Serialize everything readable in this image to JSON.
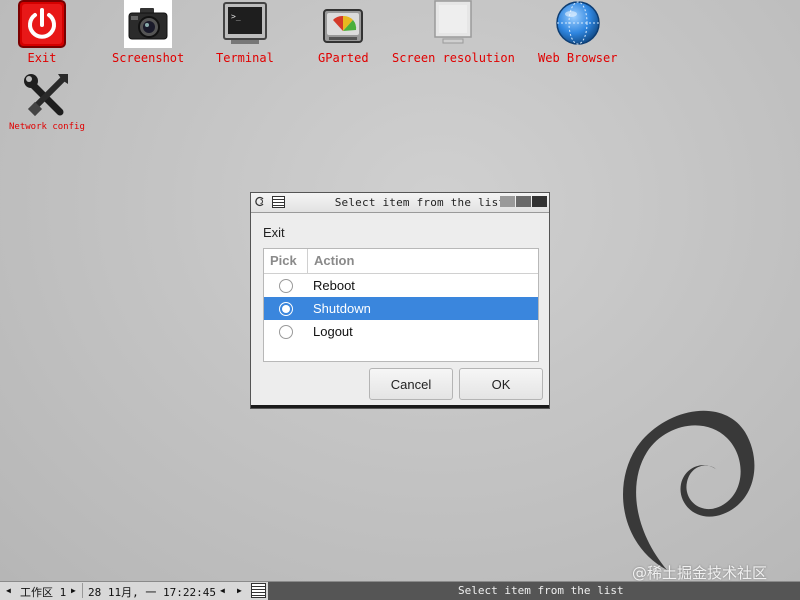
{
  "desktop": {
    "icons": [
      {
        "label": "Exit",
        "icon": "power-icon"
      },
      {
        "label": "Screenshot",
        "icon": "camera-icon"
      },
      {
        "label": "Terminal",
        "icon": "terminal-icon"
      },
      {
        "label": "GParted",
        "icon": "disk-icon"
      },
      {
        "label": "Screen resolution",
        "icon": "monitor-icon"
      },
      {
        "label": "Web Browser",
        "icon": "globe-icon"
      },
      {
        "label": "Network config",
        "icon": "tools-icon"
      }
    ],
    "label_color": "#e00000",
    "background_logo": "debian-swirl-icon"
  },
  "dialog": {
    "title": "Select item from the list",
    "prompt": "Exit",
    "columns": {
      "pick": "Pick",
      "action": "Action"
    },
    "rows": [
      {
        "label": "Reboot",
        "selected": false
      },
      {
        "label": "Shutdown",
        "selected": true
      },
      {
        "label": "Logout",
        "selected": false
      }
    ],
    "selection_color": "#3a86dd",
    "cancel_label": "Cancel",
    "ok_label": "OK"
  },
  "taskbar": {
    "workspace": "工作区 1",
    "datetime": "28 11月, 一 17:22:45",
    "active_task": "Select item from the list"
  },
  "watermark": "@稀土掘金技术社区"
}
